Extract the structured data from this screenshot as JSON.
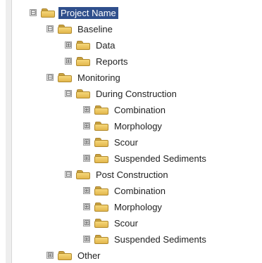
{
  "tree": {
    "root": {
      "label": "Project Name",
      "toggle": "⊟"
    },
    "baseline": {
      "label": "Baseline",
      "toggle": "⊟"
    },
    "data": {
      "label": "Data",
      "toggle": "⊞"
    },
    "reports": {
      "label": "Reports",
      "toggle": "⊞"
    },
    "monitoring": {
      "label": "Monitoring",
      "toggle": "⊟"
    },
    "during_construction": {
      "label": "During Construction",
      "toggle": "⊟"
    },
    "during_combination": {
      "label": "Combination",
      "toggle": "⊞"
    },
    "during_morphology": {
      "label": "Morphology",
      "toggle": "⊞"
    },
    "during_scour": {
      "label": "Scour",
      "toggle": "⊞"
    },
    "during_suspended_sediments": {
      "label": "Suspended Sediments",
      "toggle": "⊞"
    },
    "post_construction": {
      "label": "Post Construction",
      "toggle": "⊟"
    },
    "post_combination": {
      "label": "Combination",
      "toggle": "⊞"
    },
    "post_morphology": {
      "label": "Morphology",
      "toggle": "⊞"
    },
    "post_scour": {
      "label": "Scour",
      "toggle": "⊞"
    },
    "post_suspended_sediments": {
      "label": "Suspended Sediments",
      "toggle": "⊞"
    },
    "other": {
      "label": "Other",
      "toggle": "⊞"
    }
  }
}
